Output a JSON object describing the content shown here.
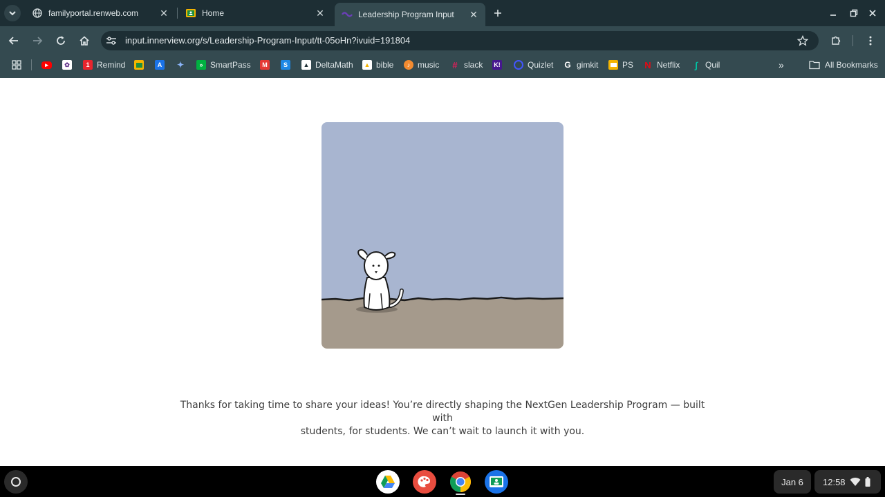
{
  "tabs": [
    {
      "title": "familyportal.renweb.com",
      "favicon": "globe-icon"
    },
    {
      "title": "Home",
      "favicon": "google-classroom-icon"
    },
    {
      "title": "Leadership Program Input",
      "favicon": "innerview-icon",
      "active": true
    }
  ],
  "address_bar": {
    "url": "input.innerview.org/s/Leadership-Program-Input/tt-05oHn?ivuid=191804"
  },
  "bookmarks": [
    {
      "label": "",
      "icon": "youtube-icon",
      "color": "#ff0000"
    },
    {
      "label": "",
      "icon": "lumio-icon",
      "color": "#ffffff"
    },
    {
      "label": "Remind",
      "icon": "remind-icon",
      "color": "#e8252d"
    },
    {
      "label": "",
      "icon": "classroom-icon",
      "color": "#f4b400"
    },
    {
      "label": "",
      "icon": "app-a-icon",
      "color": "#1a73e8"
    },
    {
      "label": "",
      "icon": "bird-icon",
      "color": "#8ab4f8"
    },
    {
      "label": "SmartPass",
      "icon": "smartpass-icon",
      "color": "#00b140"
    },
    {
      "label": "",
      "icon": "m-icon",
      "color": "#e53935"
    },
    {
      "label": "",
      "icon": "s-icon",
      "color": "#1e88e5"
    },
    {
      "label": "DeltaMath",
      "icon": "deltamath-icon",
      "color": "#ffffff"
    },
    {
      "label": "bible",
      "icon": "drive-file-icon",
      "color": "#ffffff"
    },
    {
      "label": "music",
      "icon": "music-icon",
      "color": "#f28b30"
    },
    {
      "label": "slack",
      "icon": "slack-icon",
      "color": "#e01e5a"
    },
    {
      "label": "",
      "icon": "kahoot-icon",
      "color": "#46178f"
    },
    {
      "label": "Quizlet",
      "icon": "quizlet-icon",
      "color": "#4255ff"
    },
    {
      "label": "gimkit",
      "icon": "gimkit-icon",
      "color": "#ffffff"
    },
    {
      "label": "PS",
      "icon": "slides-icon",
      "color": "#f4b400"
    },
    {
      "label": "Netflix",
      "icon": "netflix-icon",
      "color": "#e50914"
    },
    {
      "label": "Quil",
      "icon": "quill-icon",
      "color": "#00c2a2"
    }
  ],
  "all_bookmarks_label": "All Bookmarks",
  "content": {
    "thanks_line1": "Thanks for taking  time to share your ideas! You’re directly shaping the NextGen Leadership Program — built with",
    "thanks_line2": "students, for students. We can’t wait to launch it with you."
  },
  "illustration": {
    "sky_color": "#a8b5d0",
    "ground_color": "#a59a8c",
    "icon": "dog-illustration"
  },
  "shelf": {
    "apps": [
      {
        "icon": "google-drive-icon"
      },
      {
        "icon": "paint-icon"
      },
      {
        "icon": "chrome-icon"
      },
      {
        "icon": "google-classroom-icon"
      }
    ],
    "date": "Jan 6",
    "time": "12:58"
  }
}
